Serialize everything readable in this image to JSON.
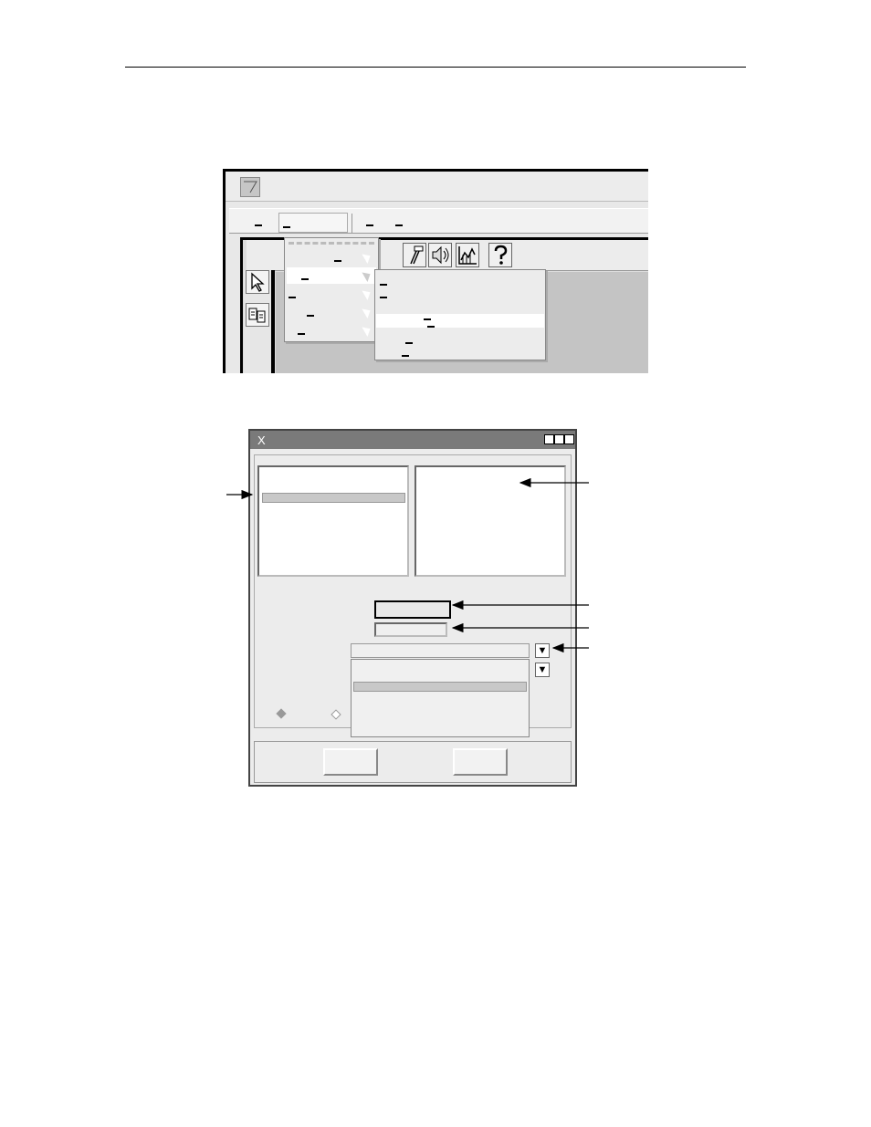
{
  "figure1": {
    "window": {
      "system_menu_icon": "triangle-down-icon"
    },
    "menubar": {
      "open_menu_index": 1,
      "item_count": 4
    },
    "dropdown": {
      "rows": 5,
      "selected_row": 1
    },
    "submenu": {
      "rows": 6,
      "selected_row": 3
    },
    "toolbar_icons": [
      "paint-tool-icon",
      "speaker-icon",
      "chart-icon",
      "help-icon"
    ],
    "left_tools": [
      "pointer-arrow-icon",
      "connect-icon"
    ]
  },
  "figure2": {
    "dialog": {
      "title": "X",
      "window_buttons": [
        "minimize-icon",
        "maximize-icon",
        "close-icon"
      ]
    },
    "left_list": {
      "selected_row": 1
    },
    "combo": {
      "button_glyph": "▼"
    },
    "combo_list": {
      "selected_row": 1
    },
    "radios": [
      {
        "state": "checked"
      },
      {
        "state": "unchecked"
      }
    ],
    "buttons": 2
  },
  "colors": {
    "canvas": "#c4c4c4",
    "title_bar": "#7a7a7a",
    "selection": "#ffffff"
  }
}
